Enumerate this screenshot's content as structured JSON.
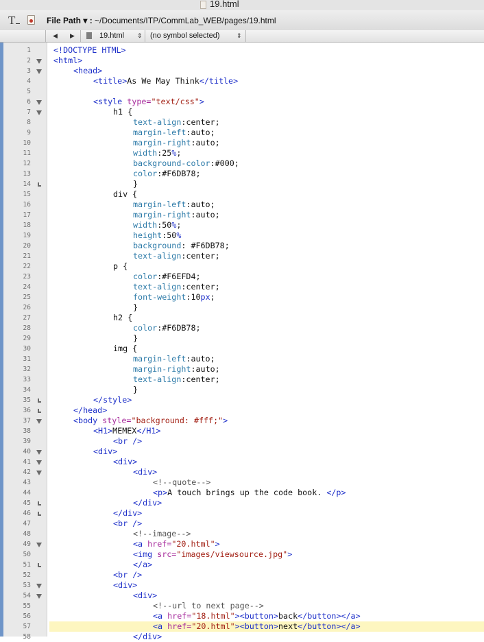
{
  "window": {
    "title": "19.html"
  },
  "toolbar": {
    "file_path_label": "File Path",
    "file_path_value": "~/Documents/ITP/CommLab_WEB/pages/19.html"
  },
  "navbar": {
    "file_name": "19.html",
    "symbol": "(no symbol selected)"
  },
  "editor": {
    "current_line": 57,
    "lines": [
      {
        "n": "1",
        "fold": "",
        "indent": 0,
        "tokens": [
          [
            "tg",
            "<!DOCTYPE HTML>"
          ]
        ]
      },
      {
        "n": "2",
        "fold": "open",
        "indent": 0,
        "tokens": [
          [
            "tg",
            "<html>"
          ]
        ]
      },
      {
        "n": "3",
        "fold": "open",
        "indent": 1,
        "tokens": [
          [
            "tg",
            "<head>"
          ]
        ]
      },
      {
        "n": "4",
        "fold": "",
        "indent": 2,
        "tokens": [
          [
            "tg",
            "<title>"
          ],
          [
            "tx",
            "As We May Think"
          ],
          [
            "tg",
            "</title>"
          ]
        ]
      },
      {
        "n": "5",
        "fold": "",
        "indent": 0,
        "tokens": []
      },
      {
        "n": "6",
        "fold": "open",
        "indent": 2,
        "tokens": [
          [
            "tg",
            "<style "
          ],
          [
            "at",
            "type="
          ],
          [
            "av",
            "\"text/css\""
          ],
          [
            "tg",
            ">"
          ]
        ]
      },
      {
        "n": "7",
        "fold": "open",
        "indent": 3,
        "tokens": [
          [
            "tx",
            "h1 {"
          ]
        ]
      },
      {
        "n": "8",
        "fold": "",
        "indent": 4,
        "tokens": [
          [
            "pr",
            "text-align"
          ],
          [
            "tx",
            ":center;"
          ]
        ]
      },
      {
        "n": "9",
        "fold": "",
        "indent": 4,
        "tokens": [
          [
            "pr",
            "margin-left"
          ],
          [
            "tx",
            ":auto;"
          ]
        ]
      },
      {
        "n": "10",
        "fold": "",
        "indent": 4,
        "tokens": [
          [
            "pr",
            "margin-right"
          ],
          [
            "tx",
            ":auto;"
          ]
        ]
      },
      {
        "n": "11",
        "fold": "",
        "indent": 4,
        "tokens": [
          [
            "pr",
            "width"
          ],
          [
            "tx",
            ":25"
          ],
          [
            "num",
            "%"
          ],
          [
            "tx",
            ";"
          ]
        ]
      },
      {
        "n": "12",
        "fold": "",
        "indent": 4,
        "tokens": [
          [
            "pr",
            "background-color"
          ],
          [
            "tx",
            ":#000;"
          ]
        ]
      },
      {
        "n": "13",
        "fold": "",
        "indent": 4,
        "tokens": [
          [
            "pr",
            "color"
          ],
          [
            "tx",
            ":#F6DB78;"
          ]
        ]
      },
      {
        "n": "14",
        "fold": "close",
        "indent": 4,
        "tokens": [
          [
            "tx",
            "}"
          ]
        ]
      },
      {
        "n": "15",
        "fold": "",
        "indent": 3,
        "tokens": [
          [
            "tx",
            "div {"
          ]
        ]
      },
      {
        "n": "16",
        "fold": "",
        "indent": 4,
        "tokens": [
          [
            "pr",
            "margin-left"
          ],
          [
            "tx",
            ":auto;"
          ]
        ]
      },
      {
        "n": "17",
        "fold": "",
        "indent": 4,
        "tokens": [
          [
            "pr",
            "margin-right"
          ],
          [
            "tx",
            ":auto;"
          ]
        ]
      },
      {
        "n": "18",
        "fold": "",
        "indent": 4,
        "tokens": [
          [
            "pr",
            "width"
          ],
          [
            "tx",
            ":50"
          ],
          [
            "num",
            "%"
          ],
          [
            "tx",
            ";"
          ]
        ]
      },
      {
        "n": "19",
        "fold": "",
        "indent": 4,
        "tokens": [
          [
            "pr",
            "height"
          ],
          [
            "tx",
            ":50"
          ],
          [
            "num",
            "%"
          ]
        ]
      },
      {
        "n": "20",
        "fold": "",
        "indent": 4,
        "tokens": [
          [
            "pr",
            "background"
          ],
          [
            "tx",
            ": #F6DB78;"
          ]
        ]
      },
      {
        "n": "21",
        "fold": "",
        "indent": 4,
        "tokens": [
          [
            "pr",
            "text-align"
          ],
          [
            "tx",
            ":center;"
          ]
        ]
      },
      {
        "n": "22",
        "fold": "",
        "indent": 3,
        "tokens": [
          [
            "tx",
            "p {"
          ]
        ]
      },
      {
        "n": "23",
        "fold": "",
        "indent": 4,
        "tokens": [
          [
            "pr",
            "color"
          ],
          [
            "tx",
            ":#F6EFD4;"
          ]
        ]
      },
      {
        "n": "24",
        "fold": "",
        "indent": 4,
        "tokens": [
          [
            "pr",
            "text-align"
          ],
          [
            "tx",
            ":center;"
          ]
        ]
      },
      {
        "n": "25",
        "fold": "",
        "indent": 4,
        "tokens": [
          [
            "pr",
            "font-weight"
          ],
          [
            "tx",
            ":10"
          ],
          [
            "num",
            "px"
          ],
          [
            "tx",
            ";"
          ]
        ]
      },
      {
        "n": "26",
        "fold": "",
        "indent": 4,
        "tokens": [
          [
            "tx",
            "}"
          ]
        ]
      },
      {
        "n": "27",
        "fold": "",
        "indent": 3,
        "tokens": [
          [
            "tx",
            "h2 {"
          ]
        ]
      },
      {
        "n": "28",
        "fold": "",
        "indent": 4,
        "tokens": [
          [
            "pr",
            "color"
          ],
          [
            "tx",
            ":#F6DB78;"
          ]
        ]
      },
      {
        "n": "29",
        "fold": "",
        "indent": 4,
        "tokens": [
          [
            "tx",
            "}"
          ]
        ]
      },
      {
        "n": "30",
        "fold": "",
        "indent": 3,
        "tokens": [
          [
            "tx",
            "img {"
          ]
        ]
      },
      {
        "n": "31",
        "fold": "",
        "indent": 4,
        "tokens": [
          [
            "pr",
            "margin-left"
          ],
          [
            "tx",
            ":auto;"
          ]
        ]
      },
      {
        "n": "32",
        "fold": "",
        "indent": 4,
        "tokens": [
          [
            "pr",
            "margin-right"
          ],
          [
            "tx",
            ":auto;"
          ]
        ]
      },
      {
        "n": "33",
        "fold": "",
        "indent": 4,
        "tokens": [
          [
            "pr",
            "text-align"
          ],
          [
            "tx",
            ":center;"
          ]
        ]
      },
      {
        "n": "34",
        "fold": "",
        "indent": 4,
        "tokens": [
          [
            "tx",
            "}"
          ]
        ]
      },
      {
        "n": "35",
        "fold": "close",
        "indent": 2,
        "tokens": [
          [
            "tg",
            "</style>"
          ]
        ]
      },
      {
        "n": "36",
        "fold": "close",
        "indent": 1,
        "tokens": [
          [
            "tg",
            "</head>"
          ]
        ]
      },
      {
        "n": "37",
        "fold": "open",
        "indent": 1,
        "tokens": [
          [
            "tg",
            "<body "
          ],
          [
            "at",
            "style="
          ],
          [
            "av",
            "\"background: #fff;\""
          ],
          [
            "tg",
            ">"
          ]
        ]
      },
      {
        "n": "38",
        "fold": "",
        "indent": 2,
        "tokens": [
          [
            "tg",
            "<H1>"
          ],
          [
            "tx",
            "MEMEX"
          ],
          [
            "tg",
            "</H1>"
          ]
        ]
      },
      {
        "n": "39",
        "fold": "",
        "indent": 3,
        "tokens": [
          [
            "tg",
            "<br />"
          ]
        ]
      },
      {
        "n": "40",
        "fold": "open",
        "indent": 2,
        "tokens": [
          [
            "tg",
            "<div>"
          ]
        ]
      },
      {
        "n": "41",
        "fold": "open",
        "indent": 3,
        "tokens": [
          [
            "tg",
            "<div>"
          ]
        ]
      },
      {
        "n": "42",
        "fold": "open",
        "indent": 4,
        "tokens": [
          [
            "tg",
            "<div>"
          ]
        ]
      },
      {
        "n": "43",
        "fold": "",
        "indent": 5,
        "tokens": [
          [
            "cm",
            "<!--quote-->"
          ]
        ]
      },
      {
        "n": "44",
        "fold": "",
        "indent": 5,
        "tokens": [
          [
            "tg",
            "<p>"
          ],
          [
            "tx",
            "A touch brings up the code book. "
          ],
          [
            "tg",
            "</p>"
          ]
        ]
      },
      {
        "n": "45",
        "fold": "close",
        "indent": 4,
        "tokens": [
          [
            "tg",
            "</div>"
          ]
        ]
      },
      {
        "n": "46",
        "fold": "close",
        "indent": 3,
        "tokens": [
          [
            "tg",
            "</div>"
          ]
        ]
      },
      {
        "n": "47",
        "fold": "",
        "indent": 3,
        "tokens": [
          [
            "tg",
            "<br />"
          ]
        ]
      },
      {
        "n": "48",
        "fold": "",
        "indent": 4,
        "tokens": [
          [
            "cm",
            "<!--image-->"
          ]
        ]
      },
      {
        "n": "49",
        "fold": "open",
        "indent": 4,
        "tokens": [
          [
            "tg",
            "<a "
          ],
          [
            "at",
            "href="
          ],
          [
            "av",
            "\"20.html\""
          ],
          [
            "tg",
            ">"
          ]
        ]
      },
      {
        "n": "50",
        "fold": "",
        "indent": 4,
        "tokens": [
          [
            "tg",
            "<img "
          ],
          [
            "at",
            "src="
          ],
          [
            "av",
            "\"images/viewsource.jpg\""
          ],
          [
            "tg",
            ">"
          ]
        ]
      },
      {
        "n": "51",
        "fold": "close",
        "indent": 4,
        "tokens": [
          [
            "tg",
            "</a>"
          ]
        ]
      },
      {
        "n": "52",
        "fold": "",
        "indent": 3,
        "tokens": [
          [
            "tg",
            "<br />"
          ]
        ]
      },
      {
        "n": "53",
        "fold": "open",
        "indent": 3,
        "tokens": [
          [
            "tg",
            "<div>"
          ]
        ]
      },
      {
        "n": "54",
        "fold": "open",
        "indent": 4,
        "tokens": [
          [
            "tg",
            "<div>"
          ]
        ]
      },
      {
        "n": "55",
        "fold": "",
        "indent": 5,
        "tokens": [
          [
            "cm",
            "<!--url to next page-->"
          ]
        ]
      },
      {
        "n": "56",
        "fold": "",
        "indent": 5,
        "tokens": [
          [
            "tg",
            "<a "
          ],
          [
            "at",
            "href="
          ],
          [
            "av",
            "\"18.html\""
          ],
          [
            "tg",
            "><button>"
          ],
          [
            "tx",
            "back"
          ],
          [
            "tg",
            "</button></a>"
          ]
        ]
      },
      {
        "n": "57",
        "fold": "",
        "indent": 5,
        "tokens": [
          [
            "tg",
            "<a "
          ],
          [
            "at",
            "href="
          ],
          [
            "av",
            "\"20.html\""
          ],
          [
            "tg",
            "><button>"
          ],
          [
            "tx",
            "next"
          ],
          [
            "tg",
            "</button></a>"
          ]
        ]
      },
      {
        "n": "58",
        "fold": "",
        "indent": 4,
        "tokens": [
          [
            "tg",
            "</div>"
          ]
        ]
      }
    ]
  }
}
